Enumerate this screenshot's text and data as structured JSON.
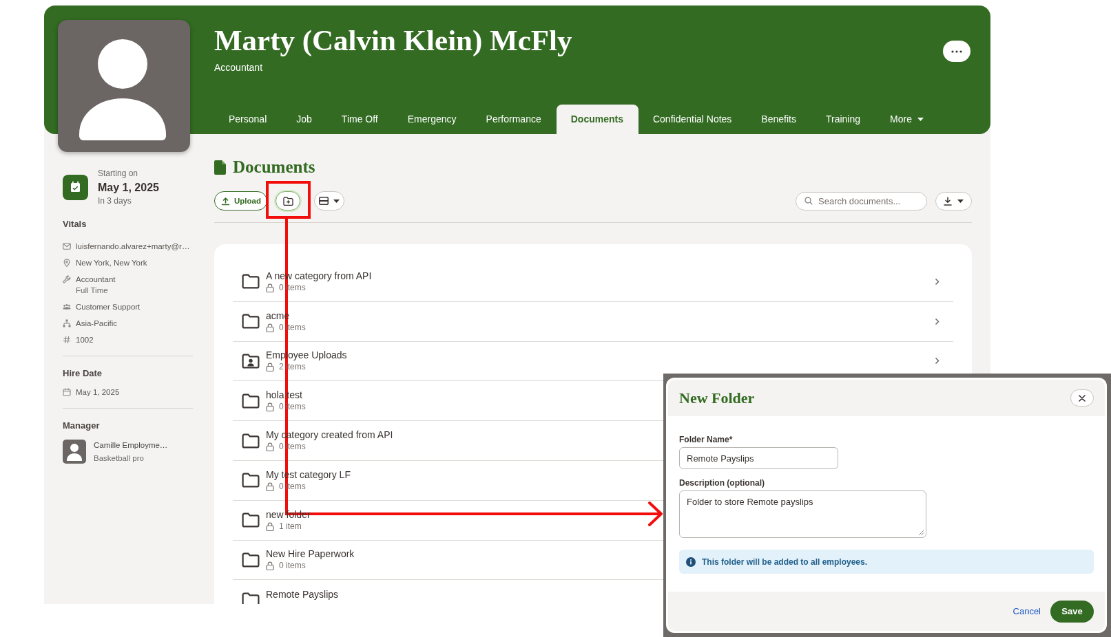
{
  "header": {
    "name": "Marty (Calvin Klein) McFly",
    "job_title": "Accountant",
    "tabs": [
      {
        "kind": "tab",
        "label": "Personal",
        "selected": false
      },
      {
        "kind": "tab",
        "label": "Job",
        "selected": false
      },
      {
        "kind": "tab",
        "label": "Time Off",
        "selected": false
      },
      {
        "kind": "tab",
        "label": "Emergency",
        "selected": false
      },
      {
        "kind": "tab",
        "label": "Performance",
        "selected": false
      },
      {
        "kind": "tab",
        "label": "Documents",
        "selected": true
      },
      {
        "kind": "tab",
        "label": "Confidential Notes",
        "selected": false
      },
      {
        "kind": "tab",
        "label": "Benefits",
        "selected": false
      },
      {
        "kind": "tab",
        "label": "Training",
        "selected": false
      },
      {
        "kind": "menu",
        "label": "More",
        "selected": false
      }
    ]
  },
  "sidebar": {
    "start": {
      "label": "Starting on",
      "date": "May 1, 2025",
      "note": "In 3 days"
    },
    "vitals": {
      "title": "Vitals",
      "items": [
        {
          "kind": "email",
          "text": "luisfernando.alvarez+marty@r…"
        },
        {
          "kind": "location",
          "text": "New York, New York"
        },
        {
          "kind": "job",
          "text": "Accountant",
          "detail": "Full Time"
        },
        {
          "kind": "department",
          "text": "Customer Support"
        },
        {
          "kind": "division",
          "text": "Asia-Pacific"
        },
        {
          "kind": "employee_number",
          "text": "1002"
        }
      ]
    },
    "hire_date": {
      "title": "Hire Date",
      "date": "May 1, 2025"
    },
    "manager": {
      "title": "Manager",
      "name": "Camille Employme…",
      "job_title": "Basketball pro"
    }
  },
  "documents": {
    "title": "Documents",
    "upload_label": "Upload",
    "new_folder_button": {
      "focused": true
    },
    "search_placeholder": "Search documents...",
    "folders": [
      {
        "kind": "standard",
        "name": "A new category from API",
        "count": "0 items"
      },
      {
        "kind": "standard",
        "name": "acme",
        "count": "0 items"
      },
      {
        "kind": "personal",
        "name": "Employee Uploads",
        "count": "2 items"
      },
      {
        "kind": "standard",
        "name": "hola test",
        "count": "0 items"
      },
      {
        "kind": "standard",
        "name": "My category created from API",
        "count": "0 items"
      },
      {
        "kind": "standard",
        "name": "My test category LF",
        "count": "0 items"
      },
      {
        "kind": "standard",
        "name": "new folder",
        "count": "1 item"
      },
      {
        "kind": "standard",
        "name": "New Hire Paperwork",
        "count": "0 items"
      },
      {
        "kind": "standard",
        "name": "Remote Payslips"
      }
    ]
  },
  "dialog": {
    "title": "New Folder",
    "fields": [
      {
        "kind": "input",
        "label": "Folder Name*",
        "value": "Remote Payslips"
      },
      {
        "kind": "textarea",
        "label": "Description (optional)",
        "value": "Folder to store Remote payslips"
      }
    ],
    "notice": "This folder will be added to all employees.",
    "cancel_label": "Cancel",
    "save_label": "Save"
  }
}
